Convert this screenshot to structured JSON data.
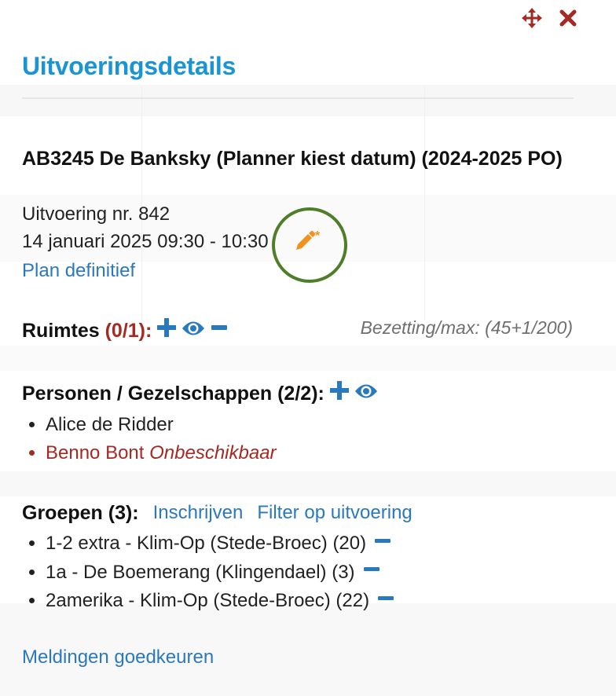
{
  "dialog": {
    "title": "Uitvoeringsdetails",
    "move_icon": "move-icon",
    "close_icon": "close-icon"
  },
  "production": {
    "title": "AB3245 De Banksky (Planner kiest datum) (2024-2025 PO)",
    "performance_number": "Uitvoering nr. 842",
    "datetime": "14 januari 2025 09:30 - 10:30",
    "edit_icon": "pencil-asterisk-icon",
    "plan_definitive_link": "Plan definitief"
  },
  "rooms": {
    "label": "Ruimtes",
    "count": "(0/1):",
    "occupancy": "Bezetting/max: (45+1/200)"
  },
  "persons": {
    "label": "Personen / Gezelschappen (2/2):",
    "items": [
      {
        "name": "Alice de Ridder",
        "status": ""
      },
      {
        "name": "Benno Bont",
        "status": "Onbeschikbaar"
      }
    ]
  },
  "groups": {
    "label": "Groepen (3):",
    "enroll_link": "Inschrijven",
    "filter_link": "Filter op uitvoering",
    "items": [
      "1-2 extra - Klim-Op (Stede-Broec) (20)",
      "1a - De Boemerang (Klingendael) (3)",
      "2amerika - Klim-Op (Stede-Broec) (22)"
    ]
  },
  "footer": {
    "approve_link": "Meldingen goedkeuren"
  },
  "colors": {
    "title": "#1a95d2",
    "link": "#2b79bd",
    "red": "#a52a22",
    "icon_blue": "#2b79bd",
    "pencil": "#f0921e",
    "highlight": "#4f7e2b"
  }
}
